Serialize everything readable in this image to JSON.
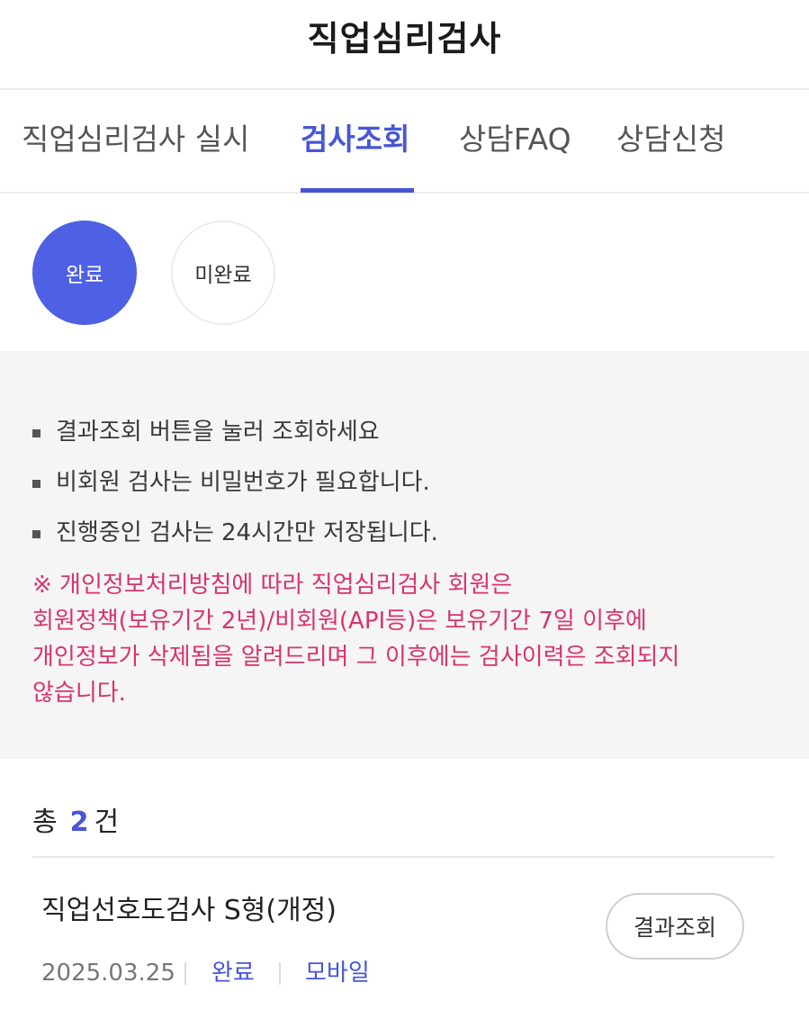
{
  "header": {
    "title": "직업심리검사"
  },
  "tabs": [
    {
      "label": "직업심리검사 실시",
      "active": false
    },
    {
      "label": "검사조회",
      "active": true
    },
    {
      "label": "상담FAQ",
      "active": false
    },
    {
      "label": "상담신청",
      "active": false
    }
  ],
  "filters": {
    "complete": "완료",
    "incomplete": "미완료",
    "selected": "완료"
  },
  "notice": {
    "bullets": [
      "결과조회 버튼을 눌러 조회하세요",
      "비회원 검사는 비밀번호가 필요합니다.",
      "진행중인 검사는 24시간만 저장됩니다."
    ],
    "warning_lines": [
      "※ 개인정보처리방침에 따라 직업심리검사 회원은",
      "회원정책(보유기간 2년)/비회원(API등)은 보유기간 7일 이후에",
      "개인정보가 삭제됨을 알려드리며 그 이후에는 검사이력은 조회되지",
      "않습니다."
    ]
  },
  "summary": {
    "prefix": "총",
    "count": "2",
    "suffix": "건"
  },
  "results": [
    {
      "title": "직업선호도검사 S형(개정)",
      "date": "2025.03.25",
      "status": "완료",
      "device": "모바일",
      "action_label": "결과조회"
    }
  ],
  "colors": {
    "accent": "#4656d5",
    "filter_active": "#4e60e3",
    "warning": "#d8346f",
    "notice_bg": "#f5f5f5"
  }
}
